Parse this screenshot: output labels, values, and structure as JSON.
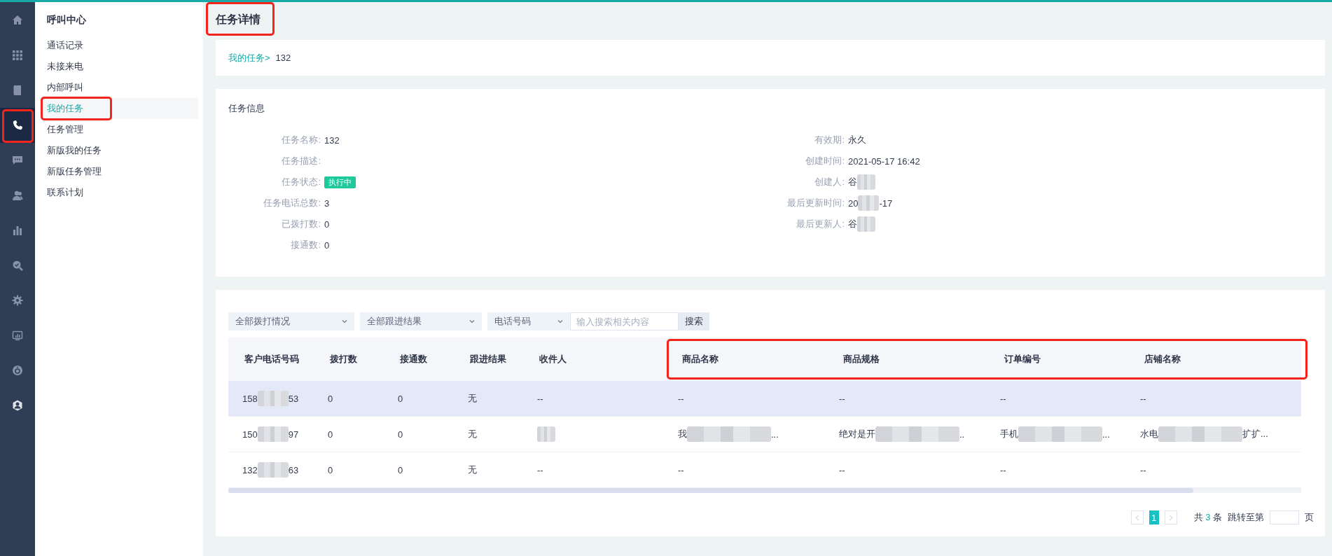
{
  "rail": {
    "items": [
      {
        "selected": false,
        "highlighted": false
      },
      {
        "selected": false,
        "highlighted": false
      },
      {
        "selected": false,
        "highlighted": false
      },
      {
        "selected": true,
        "highlighted": true
      },
      {
        "selected": false,
        "highlighted": false
      },
      {
        "selected": false,
        "highlighted": false
      },
      {
        "selected": false,
        "highlighted": false
      },
      {
        "selected": false,
        "highlighted": false
      },
      {
        "selected": false,
        "highlighted": false
      },
      {
        "selected": false,
        "highlighted": false
      },
      {
        "selected": false,
        "highlighted": false
      },
      {
        "selected": false,
        "highlighted": false
      }
    ]
  },
  "sidebar": {
    "title": "呼叫中心",
    "items": [
      {
        "label": "通话记录",
        "selected": false,
        "highlighted": false
      },
      {
        "label": "未接来电",
        "selected": false,
        "highlighted": false
      },
      {
        "label": "内部呼叫",
        "selected": false,
        "highlighted": false
      },
      {
        "label": "我的任务",
        "selected": true,
        "highlighted": true
      },
      {
        "label": "任务管理",
        "selected": false,
        "highlighted": false
      },
      {
        "label": "新版我的任务",
        "selected": false,
        "highlighted": false
      },
      {
        "label": "新版任务管理",
        "selected": false,
        "highlighted": false
      },
      {
        "label": "联系计划",
        "selected": false,
        "highlighted": false
      }
    ]
  },
  "page": {
    "title": "任务详情",
    "title_highlighted": true
  },
  "breadcrumb": {
    "link": "我的任务>",
    "current": "132"
  },
  "task_info": {
    "title": "任务信息",
    "left": [
      {
        "label": "任务名称:",
        "kind": "text",
        "value": "132"
      },
      {
        "label": "任务描述:",
        "kind": "text"
      },
      {
        "label": "任务状态:",
        "kind": "tag",
        "value": "执行中"
      },
      {
        "label": "任务电话总数:",
        "kind": "text",
        "value": "3"
      },
      {
        "label": "已拨打数:",
        "kind": "text",
        "value": "0"
      },
      {
        "label": "接通数:",
        "kind": "text",
        "value": "0"
      }
    ],
    "right": [
      {
        "label": "有效期:",
        "kind": "text",
        "value": "永久"
      },
      {
        "label": "创建时间:",
        "kind": "text",
        "value": "2021-05-17 16:42"
      },
      {
        "label": "创建人:",
        "kind": "blurred",
        "value": "谷"
      },
      {
        "label": "最后更新时间:",
        "kind": "blurred",
        "value": "20",
        "suffix": "-17"
      },
      {
        "label": "最后更新人:",
        "kind": "blurred",
        "value": "谷"
      }
    ]
  },
  "filters": [
    {
      "kind": "select",
      "value": "全部拨打情况"
    },
    {
      "kind": "select",
      "value": "全部跟进结果"
    },
    {
      "kind": "select",
      "value": "电话号码"
    },
    {
      "kind": "input",
      "placeholder": "输入搜索相关内容"
    },
    {
      "kind": "button",
      "label": "搜索"
    }
  ],
  "table": {
    "column_groups": [
      {
        "highlighted": false,
        "columns": [
          "客户电话号码",
          "拨打数",
          "接通数",
          "跟进结果",
          "收件人"
        ]
      },
      {
        "highlighted": true,
        "columns": [
          "商品名称",
          "商品规格",
          "订单编号",
          "店铺名称"
        ]
      }
    ],
    "rows": [
      {
        "selected": true,
        "cells": [
          {
            "text": "158",
            "blur": true,
            "suffix": "53"
          },
          {
            "text": "0"
          },
          {
            "text": "0"
          },
          {
            "text": "无"
          },
          {
            "text": "--"
          },
          {
            "text": "--"
          },
          {
            "text": "--"
          },
          {
            "text": "--"
          },
          {
            "text": "--"
          }
        ]
      },
      {
        "selected": false,
        "cells": [
          {
            "text": "150",
            "blur": true,
            "suffix": "97"
          },
          {
            "text": "0"
          },
          {
            "text": "0"
          },
          {
            "text": "无"
          },
          {
            "blur": true
          },
          {
            "text": "我",
            "blur": true,
            "suffix": "..."
          },
          {
            "text": "绝对是开",
            "blur": true,
            "suffix": ".."
          },
          {
            "text": "手机",
            "blur": true,
            "suffix": "..."
          },
          {
            "text": "水电",
            "blur": true,
            "suffix": "扩扩..."
          }
        ]
      },
      {
        "selected": false,
        "cells": [
          {
            "text": "132",
            "blur": true,
            "suffix": "63"
          },
          {
            "text": "0"
          },
          {
            "text": "0"
          },
          {
            "text": "无"
          },
          {
            "text": "--"
          },
          {
            "text": "--"
          },
          {
            "text": "--"
          },
          {
            "text": "--"
          },
          {
            "text": "--"
          }
        ]
      }
    ]
  },
  "pagination": {
    "pages": [
      {
        "label": "1",
        "selected": true
      }
    ],
    "total_prefix": "共",
    "total": "3",
    "total_suffix": "条",
    "jump_label": "跳转至第",
    "jump_suffix": "页"
  }
}
